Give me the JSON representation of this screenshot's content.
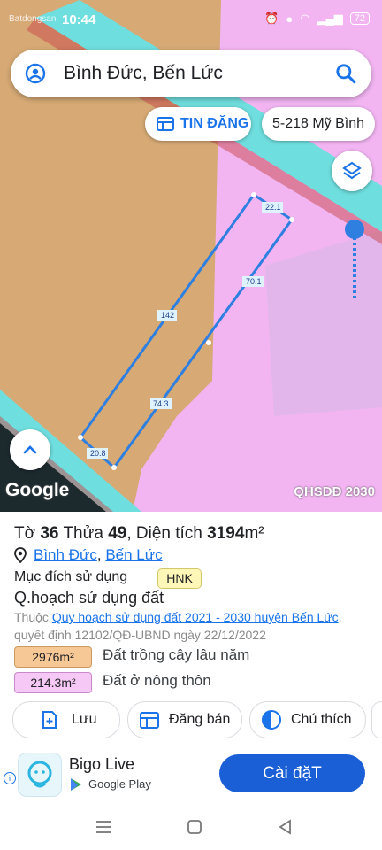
{
  "status": {
    "time": "10:44",
    "watermark": "Batdongsan",
    "battery": "72"
  },
  "search": {
    "text": "Bình Đức, Bến Lức"
  },
  "chips": {
    "listing": "TIN ĐĂNG",
    "lot": "5-218 Mỹ Bình"
  },
  "map": {
    "google": "Google",
    "layer_tag": "QHSDĐ 2030",
    "edge_labels": [
      "22.1",
      "70.1",
      "142",
      "74.3",
      "20.8"
    ],
    "zone_colors": {
      "orchard": "#d6a975",
      "residential": "#f2b5f2",
      "canal": "#7fe0e0",
      "parcel_line": "#2f7fe0"
    }
  },
  "parcel": {
    "sheet_label": "Tờ",
    "sheet": "36",
    "plot_label": "Thửa",
    "plot": "49",
    "area_label": "Diện tích",
    "area": "3194",
    "area_unit": "m²",
    "ward": "Bình Đức",
    "district": "Bến Lức",
    "purpose_label": "Mục đích sử dụng",
    "purpose_code": "HNK",
    "plan_heading": "Q.hoạch sử dụng đất",
    "plan_prefix": "Thuộc",
    "plan_link": "Quy hoạch sử dụng đất 2021 - 2030 huyện Bến Lức",
    "plan_decision": "quyết định 12102/QĐ-UBND ngày 22/12/2022",
    "zones": [
      {
        "area": "2976m²",
        "label": "Đất trồng cây lâu năm",
        "color": "#f6c896"
      },
      {
        "area": "214.3m²",
        "label": "Đất ở nông thôn",
        "color": "#f5c8f5"
      }
    ]
  },
  "actions": {
    "save": "Lưu",
    "post": "Đăng bán",
    "legend": "Chú thích"
  },
  "ad": {
    "app": "Bigo Live",
    "store": "Google Play",
    "install": "Cài đặT"
  }
}
